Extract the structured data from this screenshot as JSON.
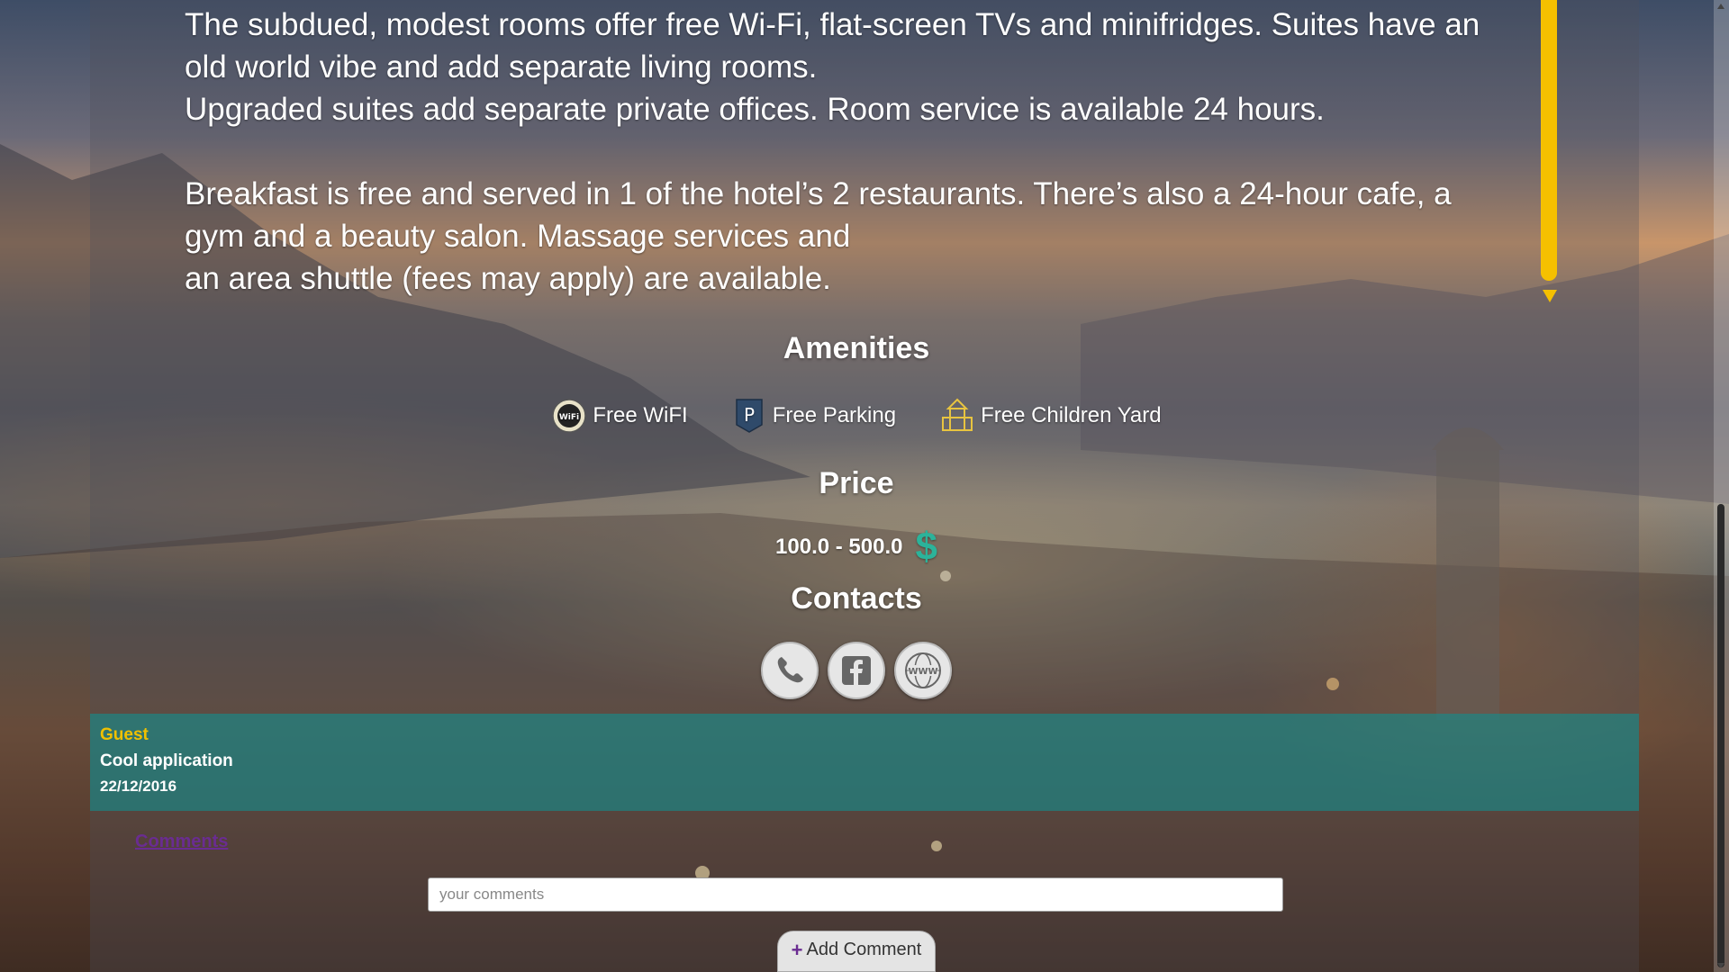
{
  "description": {
    "lines": [
      "The subdued, modest rooms offer free Wi-Fi, flat-screen TVs and minifridges. Suites have an old world vibe and add separate living rooms.",
      "Upgraded suites add separate private offices. Room service is available 24 hours.",
      "Breakfast is free and served in 1 of the hotel’s 2 restaurants. There’s also a 24-hour cafe, a gym and a beauty salon. Massage services and",
      "an area shuttle (fees may apply) are available."
    ]
  },
  "amenities": {
    "title": "Amenities",
    "items": [
      {
        "label": "Free WiFI",
        "icon": "wifi-icon"
      },
      {
        "label": "Free Parking",
        "icon": "parking-icon"
      },
      {
        "label": "Free Children Yard",
        "icon": "playground-icon"
      }
    ]
  },
  "price": {
    "title": "Price",
    "range": "100.0 - 500.0",
    "currency_icon": "dollar-icon",
    "currency_symbol": "$"
  },
  "contacts": {
    "title": "Contacts",
    "buttons": [
      "phone-icon",
      "facebook-icon",
      "www-icon"
    ],
    "www_text": "WWW"
  },
  "comment": {
    "author": "Guest",
    "text": "Cool application",
    "date": "22/12/2016"
  },
  "comments_form": {
    "label": "Comments",
    "placeholder": "your comments",
    "add_label": "Add Comment",
    "add_icon": "plus-icon"
  },
  "colors": {
    "accent_yellow": "#f5c000",
    "comment_band": "#148c8c",
    "comments_label": "#6a2c91",
    "dollar": "#2bb39a"
  }
}
